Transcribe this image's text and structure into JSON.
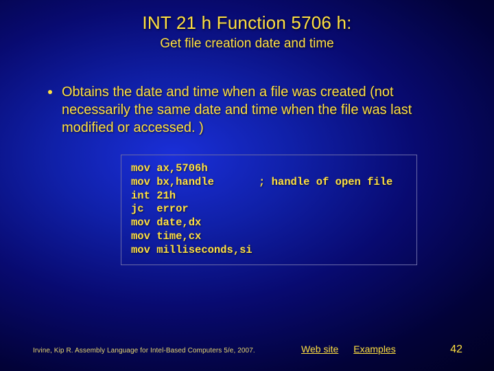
{
  "title": "INT 21 h Function 5706 h:",
  "subtitle": "Get file creation date and time",
  "bullet": "Obtains the date and time when a file was created (not necessarily the same date and time when the file was last modified or accessed. )",
  "code": "mov ax,5706h\nmov bx,handle       ; handle of open file\nint 21h\njc  error\nmov date,dx\nmov time,cx\nmov milliseconds,si",
  "footer": {
    "citation": "Irvine, Kip R. Assembly Language for Intel-Based Computers 5/e, 2007.",
    "link_website": "Web site",
    "link_examples": "Examples",
    "page": "42"
  }
}
